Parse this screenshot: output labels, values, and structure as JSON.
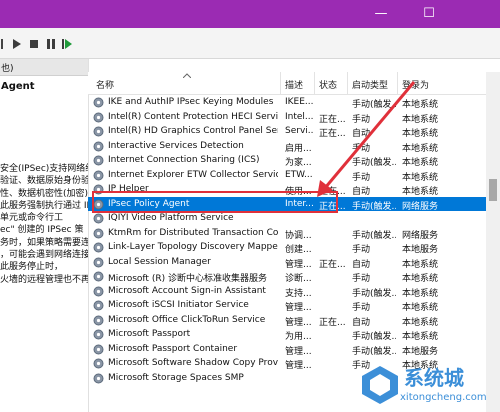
{
  "left_pane": {
    "header": "也)",
    "service_title": "Agent",
    "description_lines": [
      "安全(IPSec)支持网络级",
      "验证、数据原始身份验",
      "性、数据机密性(加密)以",
      "此服务强制执行通过 IP",
      "单元或命令行工",
      "ec\" 创建的 IPSec 策",
      "务时，如果策略需要连",
      "，可能会遇到网络连接",
      "此服务停止时，",
      "火墙的远程管理也不再可"
    ]
  },
  "columns": {
    "name": "名称",
    "description": "描述",
    "status": "状态",
    "startup": "启动类型",
    "logon": "登录为"
  },
  "rows": [
    {
      "name": "IKE and AuthIP IPsec Keying Modules",
      "desc": "IKEE...",
      "status": "",
      "startup": "手动(触发...",
      "logon": "本地系统"
    },
    {
      "name": "Intel(R) Content Protection HECI Service",
      "desc": "Intel...",
      "status": "正在...",
      "startup": "手动",
      "logon": "本地系统"
    },
    {
      "name": "Intel(R) HD Graphics Control Panel Service",
      "desc": "Servi...",
      "status": "正在...",
      "startup": "自动",
      "logon": "本地系统"
    },
    {
      "name": "Interactive Services Detection",
      "desc": "启用...",
      "status": "",
      "startup": "手动",
      "logon": "本地系统"
    },
    {
      "name": "Internet Connection Sharing (ICS)",
      "desc": "为家...",
      "status": "",
      "startup": "手动(触发...",
      "logon": "本地系统"
    },
    {
      "name": "Internet Explorer ETW Collector Service",
      "desc": "ETW...",
      "status": "",
      "startup": "手动",
      "logon": "本地系统"
    },
    {
      "name": "IP Helper",
      "desc": "使用...",
      "status": "正在...",
      "startup": "自动",
      "logon": "本地系统"
    },
    {
      "name": "IPsec Policy Agent",
      "desc": "Inter...",
      "status": "正在...",
      "startup": "手动(触发...",
      "logon": "网络服务"
    },
    {
      "name": "IQIYI Video Platform Service",
      "desc": "",
      "status": "",
      "startup": "",
      "logon": ""
    },
    {
      "name": "KtmRm for Distributed Transaction Coor...",
      "desc": "协调...",
      "status": "",
      "startup": "手动(触发...",
      "logon": "网络服务"
    },
    {
      "name": "Link-Layer Topology Discovery Mapper",
      "desc": "创建...",
      "status": "",
      "startup": "手动",
      "logon": "本地服务"
    },
    {
      "name": "Local Session Manager",
      "desc": "管理...",
      "status": "正在...",
      "startup": "自动",
      "logon": "本地系统"
    },
    {
      "name": "Microsoft (R) 诊断中心标准收集器服务",
      "desc": "诊断...",
      "status": "",
      "startup": "手动",
      "logon": "本地系统"
    },
    {
      "name": "Microsoft Account Sign-in Assistant",
      "desc": "支持...",
      "status": "",
      "startup": "手动(触发...",
      "logon": "本地系统"
    },
    {
      "name": "Microsoft iSCSI Initiator Service",
      "desc": "管理...",
      "status": "",
      "startup": "手动",
      "logon": "本地系统"
    },
    {
      "name": "Microsoft Office ClickToRun Service",
      "desc": "管理...",
      "status": "正在...",
      "startup": "自动",
      "logon": "本地系统"
    },
    {
      "name": "Microsoft Passport",
      "desc": "为用...",
      "status": "",
      "startup": "手动(触发...",
      "logon": "本地系统"
    },
    {
      "name": "Microsoft Passport Container",
      "desc": "管理...",
      "status": "",
      "startup": "手动(触发...",
      "logon": "本地服务"
    },
    {
      "name": "Microsoft Software Shadow Copy Provider",
      "desc": "管理...",
      "status": "",
      "startup": "手动",
      "logon": "本地系统"
    },
    {
      "name": "Microsoft Storage Spaces SMP",
      "desc": "",
      "status": "",
      "startup": "",
      "logon": ""
    }
  ],
  "selected_index": 7,
  "watermark": {
    "text": "系统城",
    "sub": "xitongcheng.com"
  },
  "colors": {
    "titlebar": "#9b2bb3",
    "selection": "#0078d7",
    "highlight": "#e0303a",
    "watermark": "#3c8fd8"
  },
  "icons": [
    "minimize-icon",
    "maximize-icon",
    "play-icon",
    "stop-icon",
    "pause-icon",
    "restart-icon",
    "gear-icon",
    "sort-up-icon"
  ]
}
